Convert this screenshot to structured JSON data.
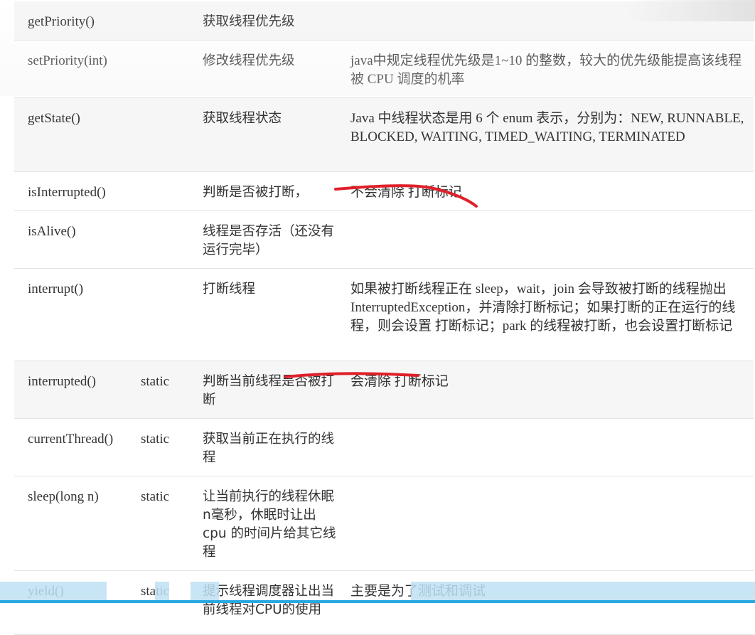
{
  "rows": [
    {
      "method": "getPriority()",
      "static": "",
      "desc": "获取线程优先级",
      "note": ""
    },
    {
      "method": "setPriority(int)",
      "static": "",
      "desc": "修改线程优先级",
      "note": "java中规定线程优先级是1~10 的整数，较大的优先级能提高该线程被 CPU 调度的机率"
    },
    {
      "method": "getState()",
      "static": "",
      "desc": "获取线程状态",
      "note": "Java 中线程状态是用 6 个 enum 表示，分别为：NEW, RUNNABLE, BLOCKED, WAITING, TIMED_WAITING, TERMINATED"
    },
    {
      "method": "isInterrupted()",
      "static": "",
      "desc": "判断是否被打断，",
      "note": "不会清除 打断标记"
    },
    {
      "method": "isAlive()",
      "static": "",
      "desc": "线程是否存活（还没有运行完毕）",
      "note": ""
    },
    {
      "method": "interrupt()",
      "static": "",
      "desc": "打断线程",
      "note": "如果被打断线程正在 sleep，wait，join 会导致被打断的线程抛出 InterruptedException，并清除打断标记；如果打断的正在运行的线程，则会设置 打断标记；park 的线程被打断，也会设置打断标记"
    },
    {
      "method": "interrupted()",
      "static": "static",
      "desc": "判断当前线程是否被打断",
      "note": "会清除 打断标记"
    },
    {
      "method": "currentThread()",
      "static": "static",
      "desc": "获取当前正在执行的线程",
      "note": ""
    },
    {
      "method": "sleep(long n)",
      "static": "static",
      "desc": "让当前执行的线程休眠n毫秒，休眠时让出 cpu 的时间片给其它线程",
      "note": ""
    },
    {
      "method": "yield()",
      "static": "static",
      "desc": "提示线程调度器让出当前线程对CPU的使用",
      "note": "主要是为了测试和调试"
    }
  ],
  "colors": {
    "ink_underline": "#e0202a",
    "bottom_bar": "#29a9e1"
  }
}
